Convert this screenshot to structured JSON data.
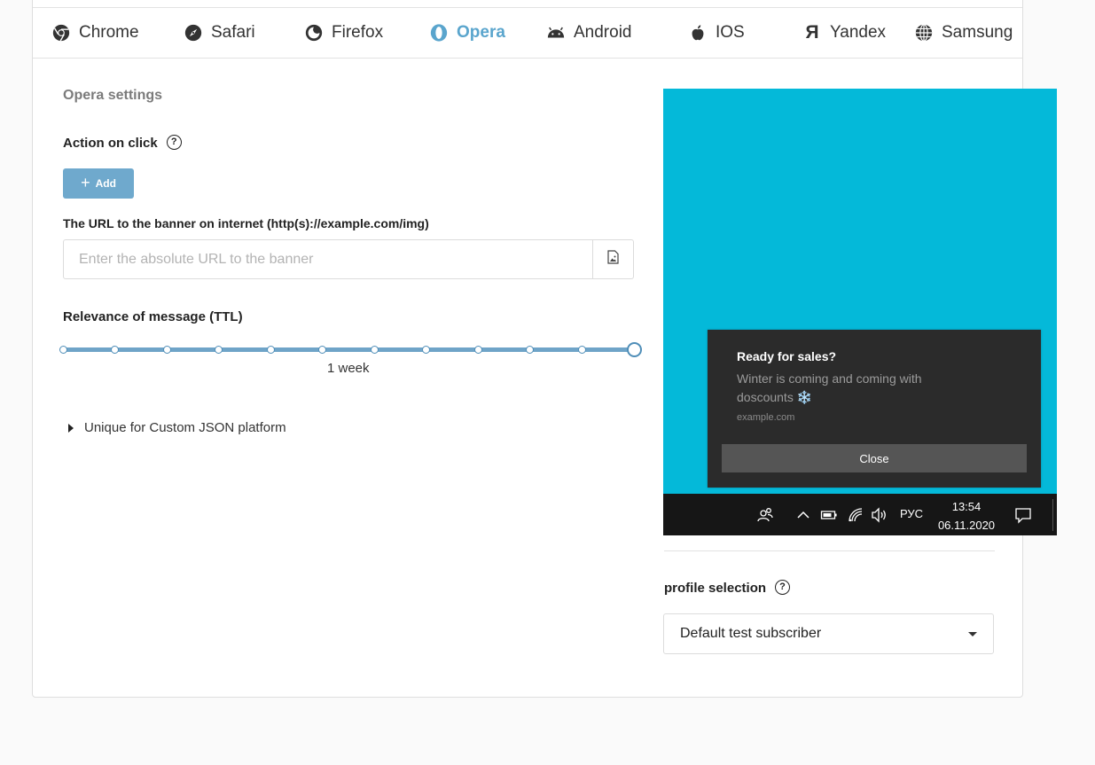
{
  "tabs": [
    {
      "label": "Chrome",
      "icon": "chrome-icon",
      "active": false
    },
    {
      "label": "Safari",
      "icon": "safari-icon",
      "active": false
    },
    {
      "label": "Firefox",
      "icon": "firefox-icon",
      "active": false
    },
    {
      "label": "Opera",
      "icon": "opera-icon",
      "active": true
    },
    {
      "label": "Android",
      "icon": "android-icon",
      "active": false
    },
    {
      "label": "IOS",
      "icon": "apple-icon",
      "active": false
    },
    {
      "label": "Yandex",
      "icon": "yandex-icon",
      "active": false
    },
    {
      "label": "Samsung",
      "icon": "globe-icon",
      "active": false
    }
  ],
  "settings": {
    "title": "Opera settings",
    "action_label": "Action on click",
    "add_label": "Add",
    "url_label": "The URL to the banner on internet (http(s)://example.com/img)",
    "url_placeholder": "Enter the absolute URL to the banner",
    "url_value": "",
    "ttl_label": "Relevance of message (TTL)",
    "ttl_value": "1 week",
    "ttl_steps": 12,
    "ttl_selected_index": 11,
    "unique_label": "Unique for Custom JSON platform"
  },
  "preview": {
    "background_color": "#04b9d9",
    "notification": {
      "title": "Ready for sales?",
      "body": "Winter is coming and coming with doscounts ❄️",
      "site": "example.com",
      "close_label": "Close"
    },
    "taskbar": {
      "lang": "РУС",
      "time": "13:54",
      "date": "06.11.2020"
    }
  },
  "profile": {
    "label": "profile selection",
    "selected": "Default test subscriber"
  },
  "colors": {
    "accent": "#5aa5cd",
    "button": "#6fa9cd",
    "slider": "#6fa4c8"
  }
}
